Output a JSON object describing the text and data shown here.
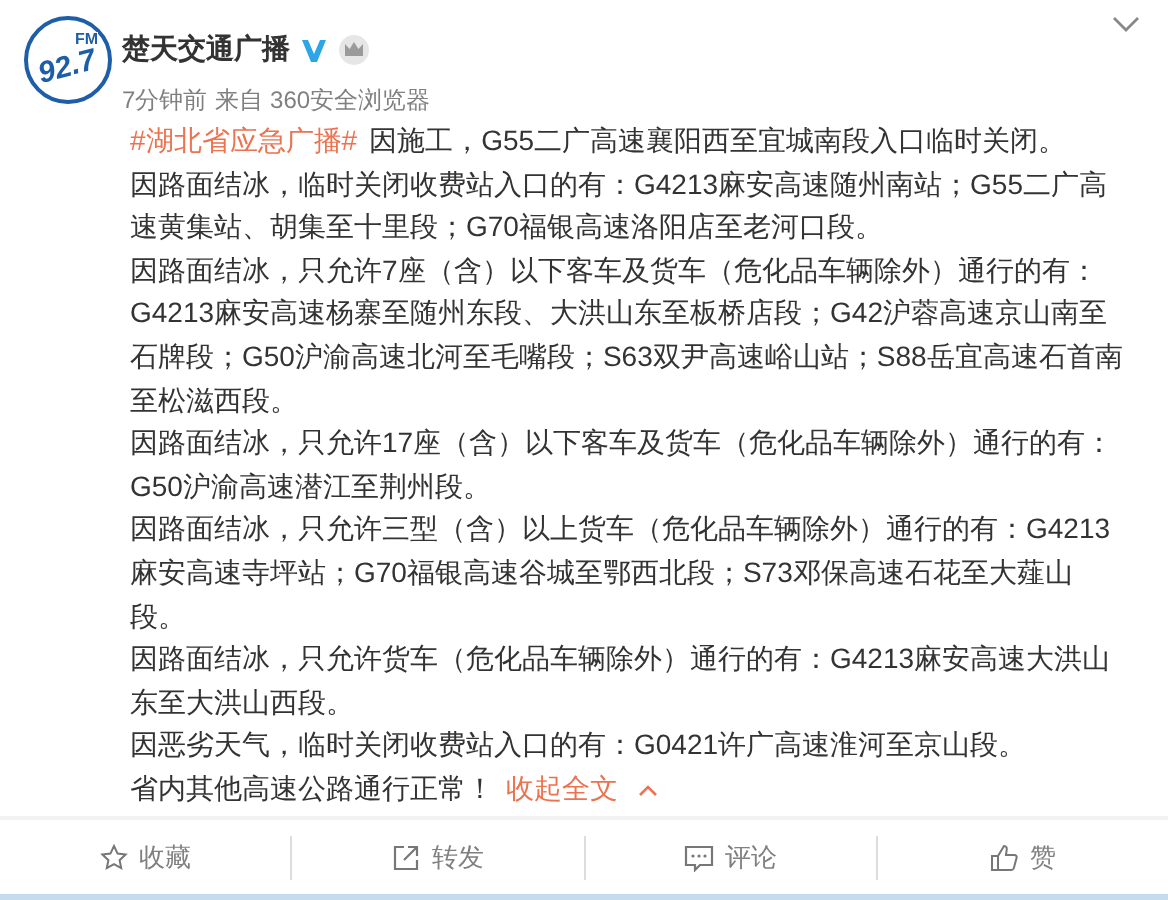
{
  "post": {
    "author": "楚天交通广播",
    "avatar": {
      "main": "92.7",
      "sub": "FM"
    },
    "verified": true,
    "crown": true,
    "time": "7分钟前",
    "source": "来自 360安全浏览器",
    "paragraphs": [
      {
        "hashtag": "#湖北省应急广播#",
        "text": "因施工，G55二广高速襄阳西至宜城南段入口临时关闭。"
      },
      {
        "text": "因路面结冰，临时关闭收费站入口的有：G4213麻安高速随州南站；G55二广高速黄集站、胡集至十里段；G70福银高速洛阳店至老河口段。"
      },
      {
        "text": "因路面结冰，只允许7座（含）以下客车及货车（危化品车辆除外）通行的有：G4213麻安高速杨寨至随州东段、大洪山东至板桥店段；G42沪蓉高速京山南至石牌段；G50沪渝高速北河至毛嘴段；S63双尹高速峪山站；S88岳宜高速石首南至松滋西段。"
      },
      {
        "text": "因路面结冰，只允许17座（含）以下客车及货车（危化品车辆除外）通行的有：G50沪渝高速潜江至荆州段。"
      },
      {
        "text": "因路面结冰，只允许三型（含）以上货车（危化品车辆除外）通行的有：G4213麻安高速寺坪站；G70福银高速谷城至鄂西北段；S73邓保高速石花至大薤山段。"
      },
      {
        "text": "因路面结冰，只允许货车（危化品车辆除外）通行的有：G4213麻安高速大洪山东至大洪山西段。"
      },
      {
        "text": "因恶劣天气，临时关闭收费站入口的有：G0421许广高速淮河至京山段。"
      },
      {
        "text": "省内其他高速公路通行正常！",
        "link": "收起全文"
      }
    ]
  },
  "actions": [
    {
      "kind": "favorite",
      "label": "收藏"
    },
    {
      "kind": "repost",
      "label": "转发"
    },
    {
      "kind": "comment",
      "label": "评论"
    },
    {
      "kind": "like",
      "label": "赞"
    }
  ]
}
